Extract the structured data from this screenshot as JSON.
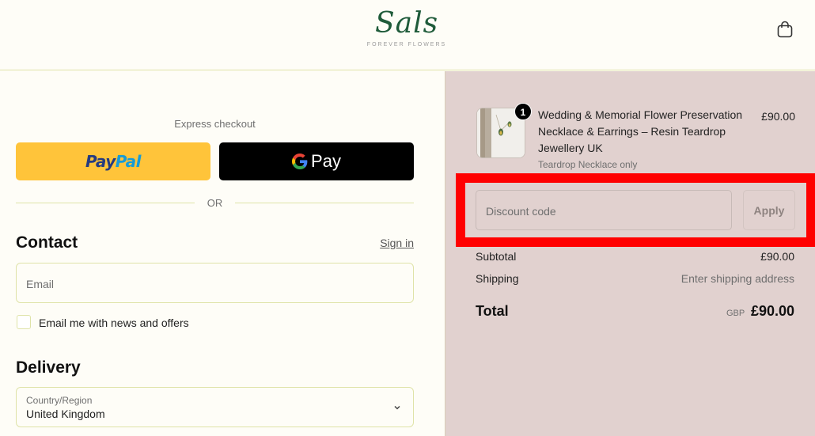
{
  "header": {
    "logo_script": "Sals",
    "logo_tagline": "FOREVER FLOWERS"
  },
  "checkout": {
    "express_label": "Express checkout",
    "paypal_part1": "Pay",
    "paypal_part2": "Pal",
    "gpay_label": "Pay",
    "or_label": "OR",
    "contact_title": "Contact",
    "sign_in_label": "Sign in",
    "email_placeholder": "Email",
    "newsletter_label": "Email me with news and offers",
    "delivery_title": "Delivery",
    "country_label": "Country/Region",
    "country_value": "United Kingdom"
  },
  "order": {
    "item": {
      "quantity": "1",
      "title": "Wedding & Memorial Flower Preservation Necklace & Earrings – Resin Teardrop Jewellery UK",
      "variant": "Teardrop Necklace only",
      "price": "£90.00"
    },
    "discount_placeholder": "Discount code",
    "apply_label": "Apply",
    "subtotal_label": "Subtotal",
    "subtotal_value": "£90.00",
    "shipping_label": "Shipping",
    "shipping_value": "Enter shipping address",
    "total_label": "Total",
    "total_currency": "GBP",
    "total_value": "£90.00"
  },
  "colors": {
    "brand_green": "#1f5b3a",
    "paypal_yellow": "#ffc43a",
    "summary_bg": "#e1d1cf",
    "highlight_red": "#ff0000"
  },
  "icons": [
    "shopping-bag-icon",
    "google-g-icon",
    "chevron-down-icon"
  ]
}
